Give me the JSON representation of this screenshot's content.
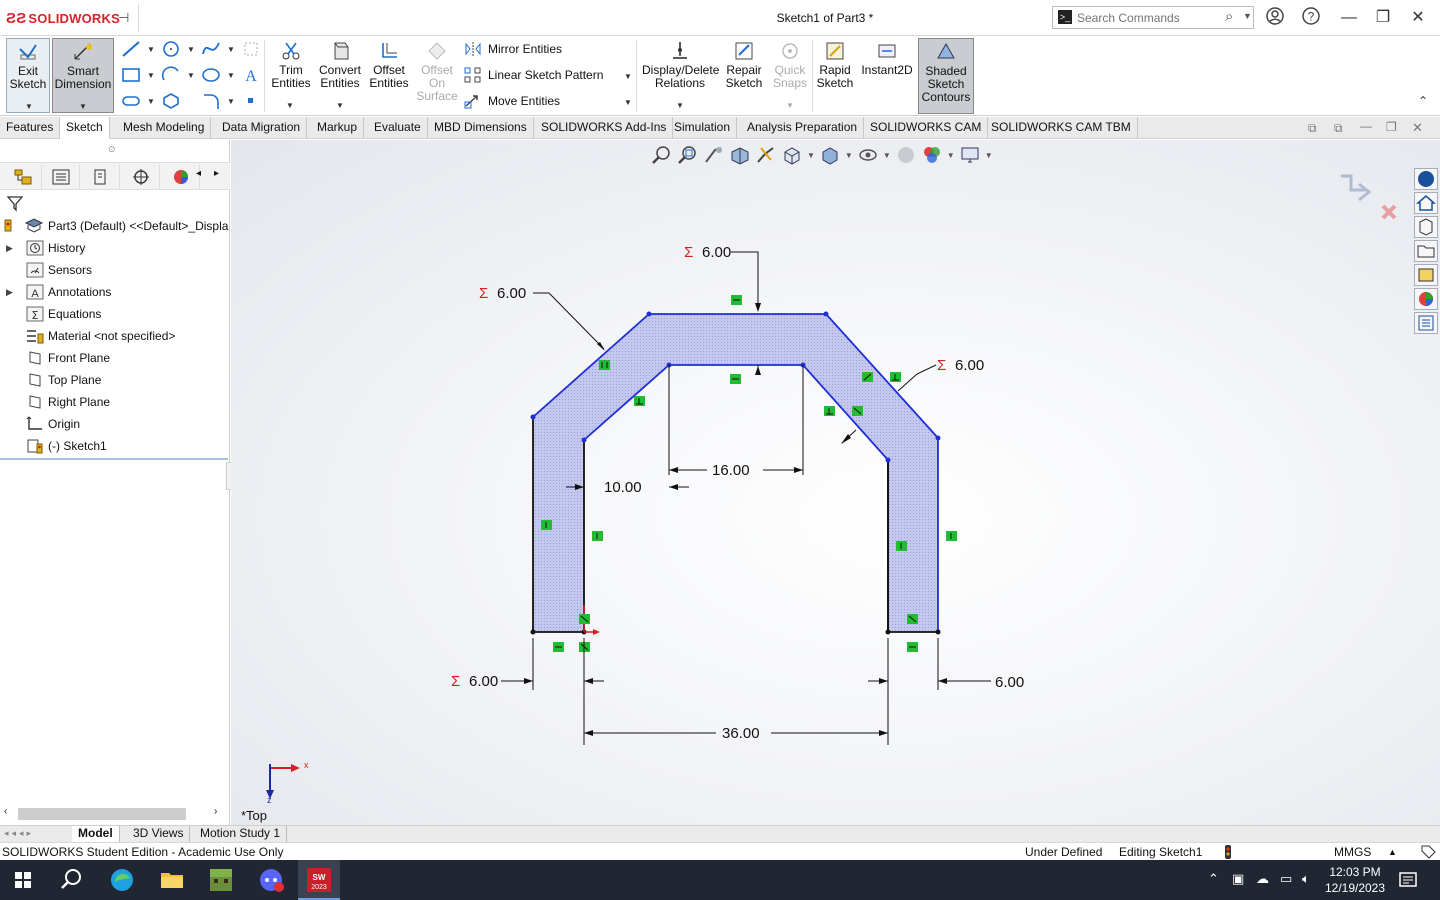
{
  "titlebar": {
    "app_name": "SOLIDWORKS",
    "doc_title": "Sketch1 of Part3 *",
    "search_placeholder": "Search Commands"
  },
  "ribbon": {
    "exit_sketch": "Exit Sketch",
    "smart_dimension": "Smart Dimension",
    "trim_entities": "Trim Entities",
    "convert_entities": "Convert Entities",
    "offset_entities": "Offset Entities",
    "offset_on_surface": "Offset On Surface",
    "mirror_entities": "Mirror Entities",
    "linear_sketch_pattern": "Linear Sketch Pattern",
    "move_entities": "Move Entities",
    "display_delete_relations": "Display/Delete Relations",
    "repair_sketch": "Repair Sketch",
    "quick_snaps": "Quick Snaps",
    "rapid_sketch": "Rapid Sketch",
    "instant2d": "Instant2D",
    "shaded_sketch_contours": "Shaded Sketch Contours"
  },
  "tabs": [
    {
      "label": "Features"
    },
    {
      "label": "Sketch"
    },
    {
      "label": "Mesh Modeling"
    },
    {
      "label": "Data Migration"
    },
    {
      "label": "Markup"
    },
    {
      "label": "Evaluate"
    },
    {
      "label": "MBD Dimensions"
    },
    {
      "label": "SOLIDWORKS Add-Ins"
    },
    {
      "label": "Simulation"
    },
    {
      "label": "Analysis Preparation"
    },
    {
      "label": "SOLIDWORKS CAM"
    },
    {
      "label": "SOLIDWORKS CAM TBM"
    }
  ],
  "active_tab": "Sketch",
  "tree": {
    "root": "Part3 (Default) <<Default>_Displa",
    "items": [
      {
        "label": "History"
      },
      {
        "label": "Sensors"
      },
      {
        "label": "Annotations"
      },
      {
        "label": "Equations"
      },
      {
        "label": "Material <not specified>"
      },
      {
        "label": "Front Plane"
      },
      {
        "label": "Top Plane"
      },
      {
        "label": "Right Plane"
      },
      {
        "label": "Origin"
      },
      {
        "label": "(-) Sketch1"
      }
    ]
  },
  "sketch": {
    "dims": {
      "top_thickness": "6.00",
      "left_slant": "6.00",
      "right_slant": "6.00",
      "inner_width": "16.00",
      "inner_offset": "10.00",
      "bottom_left": "6.00",
      "bottom_right": "6.00",
      "overall_width": "36.00"
    },
    "sigma": "Σ",
    "axis_x": "x",
    "axis_z": "z"
  },
  "view_label": "*Top",
  "bottom_tabs": [
    {
      "label": "Model"
    },
    {
      "label": "3D Views"
    },
    {
      "label": "Motion Study 1"
    }
  ],
  "status": {
    "edition": "SOLIDWORKS Student Edition - Academic Use Only",
    "definition": "Under Defined",
    "editing": "Editing Sketch1",
    "units": "MMGS"
  },
  "clock": {
    "time": "12:03 PM",
    "date": "12/19/2023"
  },
  "colors": {
    "sketch_line": "#1f2fd8",
    "sketch_fill": "#b9bde8",
    "relation_green": "#22bb33",
    "dim_sigma": "#d42020",
    "brand_red": "#d8222a"
  }
}
